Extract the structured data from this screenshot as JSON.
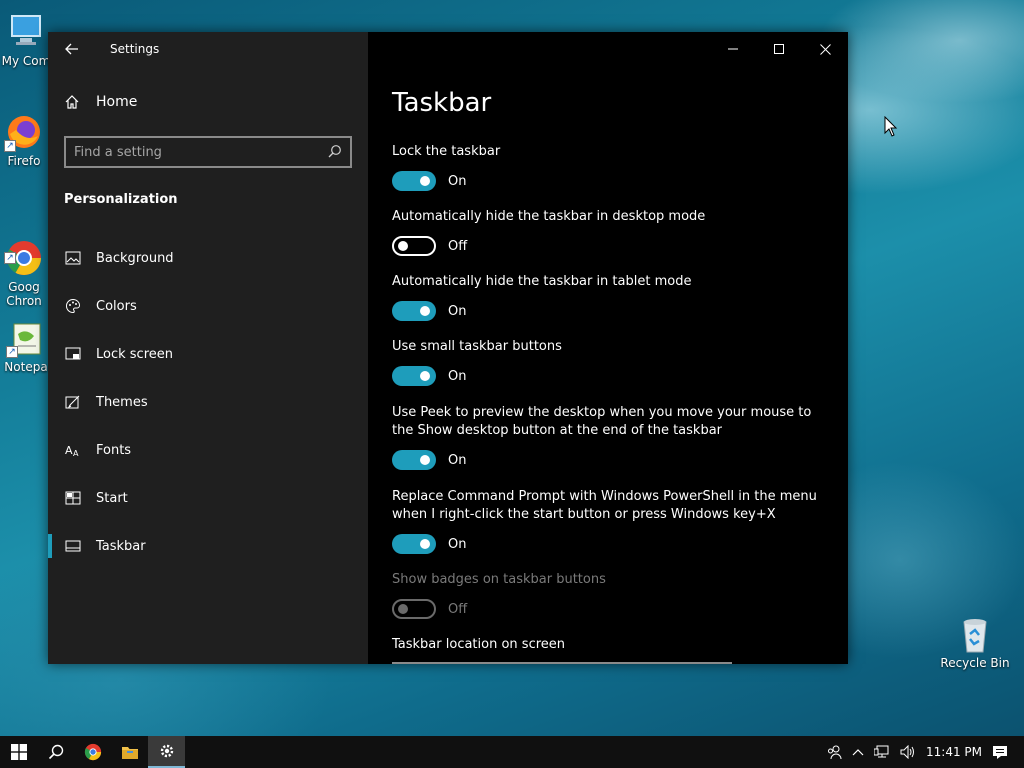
{
  "desktop": {
    "icons": [
      {
        "label": "My Com"
      },
      {
        "label": "Firefo"
      },
      {
        "label": "Goog\nChron"
      },
      {
        "label": "Notepa"
      },
      {
        "label": "Recycle Bin"
      }
    ]
  },
  "window": {
    "title": "Settings",
    "home_label": "Home",
    "search_placeholder": "Find a setting",
    "section": "Personalization",
    "nav": [
      {
        "label": "Background",
        "icon": "picture-icon"
      },
      {
        "label": "Colors",
        "icon": "palette-icon"
      },
      {
        "label": "Lock screen",
        "icon": "lock-screen-icon"
      },
      {
        "label": "Themes",
        "icon": "brush-icon"
      },
      {
        "label": "Fonts",
        "icon": "font-icon"
      },
      {
        "label": "Start",
        "icon": "start-icon"
      },
      {
        "label": "Taskbar",
        "icon": "taskbar-icon",
        "active": true
      }
    ]
  },
  "page": {
    "title": "Taskbar",
    "settings": [
      {
        "label": "Lock the taskbar",
        "state": "On"
      },
      {
        "label": "Automatically hide the taskbar in desktop mode",
        "state": "Off"
      },
      {
        "label": "Automatically hide the taskbar in tablet mode",
        "state": "On"
      },
      {
        "label": "Use small taskbar buttons",
        "state": "On"
      },
      {
        "label": "Use Peek to preview the desktop when you move your mouse to the Show desktop button at the end of the taskbar",
        "state": "On"
      },
      {
        "label": "Replace Command Prompt with Windows PowerShell in the menu when I right-click the start button or press Windows key+X",
        "state": "On"
      },
      {
        "label": "Show badges on taskbar buttons",
        "state": "Off",
        "disabled": true
      }
    ],
    "location_label": "Taskbar location on screen"
  },
  "taskbar": {
    "clock": "11:41 PM"
  },
  "colors": {
    "accent": "#1e9dbb",
    "sidebar_bg": "#1f1f1f",
    "main_bg": "#000000"
  }
}
